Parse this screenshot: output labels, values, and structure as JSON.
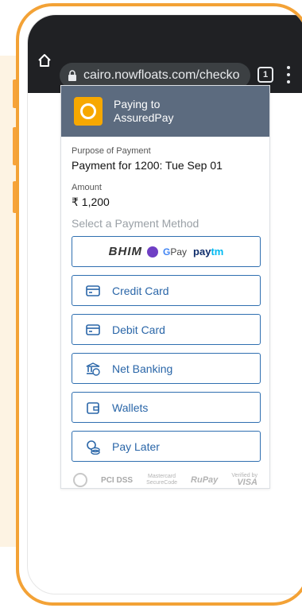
{
  "browser": {
    "url": "cairo.nowfloats.com/checko",
    "tab_count": "1"
  },
  "payment_header": {
    "line1": "Paying to",
    "line2": "AssuredPay"
  },
  "purpose": {
    "label": "Purpose of Payment",
    "value": "Payment for 1200: Tue Sep 01"
  },
  "amount": {
    "label": "Amount",
    "value": "₹ 1,200"
  },
  "methods": {
    "heading": "Select a Payment Method",
    "upi": {
      "bhim": "BHIM",
      "gpay": "Pay",
      "gpay_g": "G",
      "paytm_pay": "pay",
      "paytm_tm": "tm"
    },
    "items": [
      {
        "label": "Credit Card",
        "icon": "credit-card-icon"
      },
      {
        "label": "Debit Card",
        "icon": "debit-card-icon"
      },
      {
        "label": "Net Banking",
        "icon": "bank-icon"
      },
      {
        "label": "Wallets",
        "icon": "wallet-icon"
      },
      {
        "label": "Pay Later",
        "icon": "pay-later-icon"
      }
    ]
  },
  "badges": {
    "pci": "PCI DSS",
    "mastercard_1": "Mastercard",
    "mastercard_2": "SecureCode",
    "rupay": "RuPay",
    "visa_1": "Verified by",
    "visa_2": "VISA"
  },
  "colors": {
    "frame": "#f3a236",
    "header": "#5c6b7f",
    "accent": "#2f6fb0",
    "browser_bar": "#202124"
  }
}
